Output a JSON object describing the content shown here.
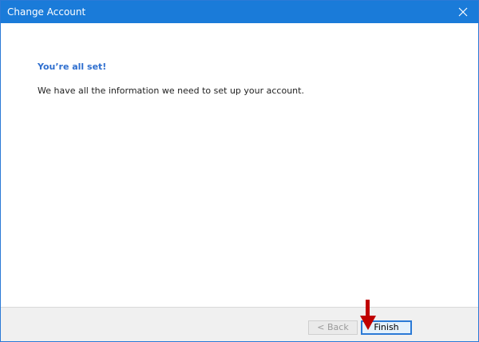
{
  "window": {
    "title": "Change Account",
    "close_glyph": "✕"
  },
  "content": {
    "heading": "You’re all set!",
    "message": "We have all the information we need to set up your account."
  },
  "footer": {
    "back_label": "< Back",
    "finish_label": "Finish"
  },
  "colors": {
    "titlebar": "#1a7bd9",
    "heading": "#2f6fcf",
    "arrow": "#c00000"
  }
}
